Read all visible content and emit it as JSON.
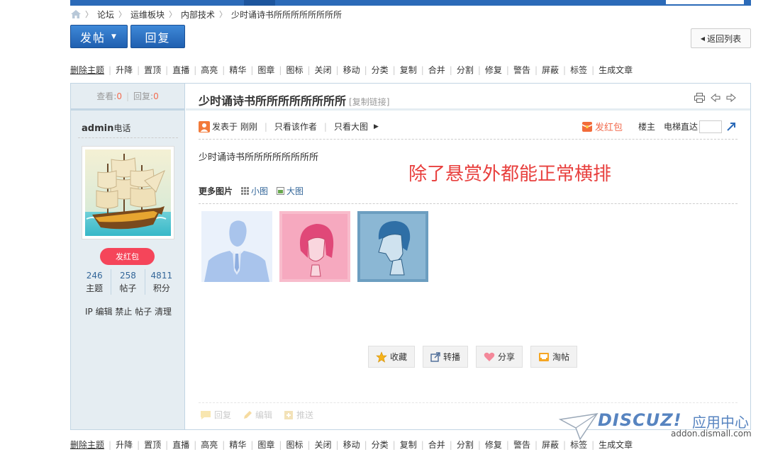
{
  "breadcrumb": {
    "items": [
      "论坛",
      "运维板块",
      "内部技术",
      "少时诵诗书所所所所所所所所"
    ]
  },
  "toolbar": {
    "post_label": "发帖",
    "reply_label": "回复",
    "back_label": "返回列表"
  },
  "moderation": [
    "删除主题",
    "升降",
    "置顶",
    "直播",
    "高亮",
    "精华",
    "图章",
    "图标",
    "关闭",
    "移动",
    "分类",
    "复制",
    "合并",
    "分割",
    "修复",
    "警告",
    "屏蔽",
    "标签",
    "生成文章"
  ],
  "thread": {
    "views_label": "查看:",
    "views": "0",
    "replies_label": "回复:",
    "replies": "0",
    "title": "少时诵诗书所所所所所所所所",
    "copy_link": "[复制链接]"
  },
  "author": {
    "name": "admin",
    "phone_label": "电话",
    "redpack_label": "发红包",
    "stats": [
      {
        "value": "246",
        "label": "主题"
      },
      {
        "value": "258",
        "label": "帖子"
      },
      {
        "value": "4811",
        "label": "积分"
      }
    ],
    "admin_links": "IP 编辑 禁止 帖子 清理"
  },
  "post": {
    "posted_at": "发表于 刚刚",
    "only_author": "只看该作者",
    "big_image": "只看大图",
    "send_redpack": "发红包",
    "floor": "楼主",
    "elevator": "电梯直达",
    "content": "少时诵诗书所所所所所所所所",
    "note": "除了悬赏外都能正常横排",
    "more_images": "更多图片",
    "small_view": "小图",
    "large_view": "大图"
  },
  "actions": [
    "收藏",
    "转播",
    "分享",
    "淘帖"
  ],
  "footer_actions": [
    "回复",
    "编辑",
    "推送"
  ],
  "watermark": {
    "brand": "DISCUZ!",
    "cn": "应用中心",
    "domain": "addon.dismall.com"
  },
  "colors": {
    "primary_blue": "#2b6ab8",
    "redpack": "#f5455a",
    "note_red": "#e8403e",
    "link_blue": "#336699",
    "side_bg": "#e5edf2"
  }
}
